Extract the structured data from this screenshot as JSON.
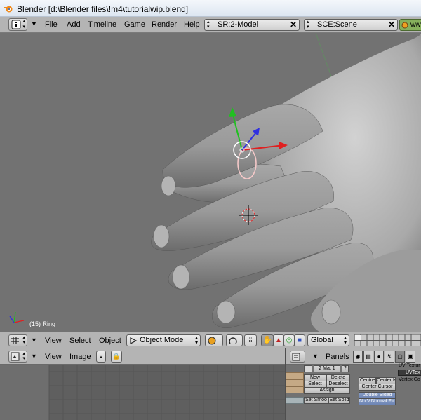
{
  "window": {
    "title": "Blender [d:\\Blender files\\!m4\\tutorialwip.blend]"
  },
  "menubar": {
    "items": [
      "File",
      "Add",
      "Timeline",
      "Game",
      "Render",
      "Help"
    ],
    "screen_field": "SR:2-Model",
    "scene_field": "SCE:Scene",
    "extra_label": "www"
  },
  "viewport": {
    "object_label": "(15) Ring"
  },
  "view3d_header": {
    "menus": [
      "View",
      "Select",
      "Object"
    ],
    "mode": "Object Mode",
    "orientation": "Global"
  },
  "image_editor_header": {
    "menus": [
      "View",
      "Image"
    ]
  },
  "buttons_window": {
    "panels_label": "Panels",
    "material_field": "2 Mat 1",
    "material_btn": "?",
    "buttons": {
      "new": "New",
      "delete": "Delete",
      "select": "Select",
      "deselect": "Deselect",
      "assign": "Assign",
      "set_smooth": "Set Smoo",
      "set_solid": "Set Solid",
      "center": "Centre",
      "center_new": "Center Ne",
      "center_cursor": "Center Cursor",
      "double_sided": "Double Sided",
      "no_v_normal_flip": "No V.Normal Flip"
    },
    "right_labels": {
      "uv_texture": "UV Textur",
      "uvtex": "UVTex",
      "vertex_col": "Vertex Co"
    }
  },
  "colors": {
    "viewport_bg": "#727272",
    "header_bg": "#b4b4b4",
    "axis_red": "#e02020",
    "axis_green": "#20c020",
    "axis_blue": "#3030e0"
  }
}
